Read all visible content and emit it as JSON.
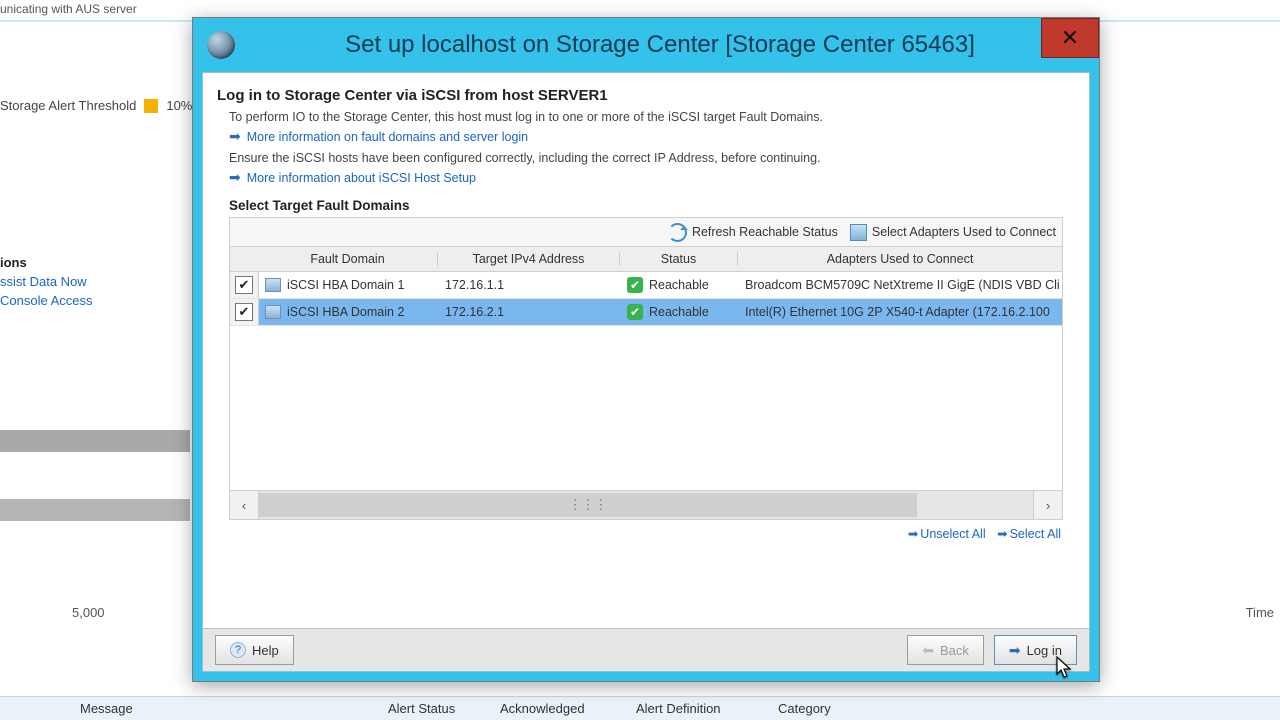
{
  "background": {
    "status": "unicating with AUS server",
    "threshold_label": "Storage Alert Threshold",
    "threshold_value": "10%",
    "ions": "ions",
    "link1": "ssist Data Now",
    "link2": "Console Access",
    "axis_tick": "5,000",
    "time_label": "Time",
    "bottom_cols": {
      "message": "Message",
      "alert_status": "Alert Status",
      "acknowledged": "Acknowledged",
      "alert_definition": "Alert Definition",
      "category": "Category"
    }
  },
  "dialog": {
    "title": "Set up localhost on Storage Center [Storage Center 65463]",
    "heading": "Log in to Storage Center via iSCSI from host SERVER1",
    "para1": "To perform IO to the Storage Center, this host must log in to one or more of the iSCSI target Fault Domains.",
    "more1": "More information on fault domains and server login",
    "para2": "Ensure the iSCSI hosts have been configured correctly, including the correct IP Address, before continuing.",
    "more2": "More information about iSCSI Host Setup",
    "section": "Select Target Fault Domains",
    "toolbar": {
      "refresh": "Refresh Reachable Status",
      "select_adapters": "Select Adapters Used to Connect"
    },
    "columns": {
      "fault_domain": "Fault Domain",
      "target_ip": "Target IPv4 Address",
      "status": "Status",
      "adapters": "Adapters Used to Connect"
    },
    "rows": [
      {
        "checked": true,
        "fault_domain": "iSCSI HBA Domain 1",
        "ip": "172.16.1.1",
        "status": "Reachable",
        "adapter": "Broadcom BCM5709C NetXtreme II GigE (NDIS VBD Cli"
      },
      {
        "checked": true,
        "fault_domain": "iSCSI HBA Domain 2",
        "ip": "172.16.2.1",
        "status": "Reachable",
        "adapter": "Intel(R) Ethernet 10G 2P X540-t Adapter (172.16.2.100"
      }
    ],
    "unselect_all": "Unselect All",
    "select_all": "Select All",
    "footer": {
      "help": "Help",
      "back": "Back",
      "login": "Log in"
    }
  }
}
